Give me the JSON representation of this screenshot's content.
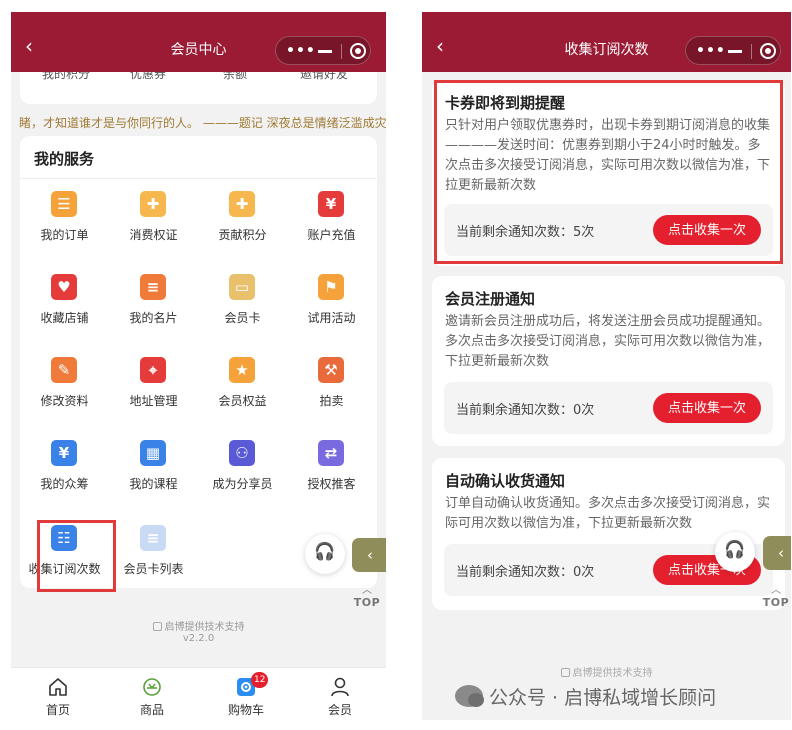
{
  "left": {
    "title": "会员中心",
    "top_card_remnants": [
      "我的积分",
      "优惠券",
      "余额",
      "邀请好友"
    ],
    "marquee": "睹，才知道谁才是与你同行的人。 ———题记 深夜总是情绪泛滥成灾\u0010",
    "service_title": "我的服务",
    "services": [
      {
        "label": "我的订单",
        "icon": "clipboard-icon",
        "color": "#f5a23a",
        "glyph": "☰"
      },
      {
        "label": "消费权证",
        "icon": "gift-icon",
        "color": "#f6b84e",
        "glyph": "✚"
      },
      {
        "label": "贡献积分",
        "icon": "gift-box-icon",
        "color": "#f6b84e",
        "glyph": "✚"
      },
      {
        "label": "账户充值",
        "icon": "recharge-icon",
        "color": "#e53b3b",
        "glyph": "¥"
      },
      {
        "label": "收藏店铺",
        "icon": "favorite-store-icon",
        "color": "#e53b3b",
        "glyph": "♥"
      },
      {
        "label": "我的名片",
        "icon": "business-card-icon",
        "color": "#f07a3a",
        "glyph": "≡"
      },
      {
        "label": "会员卡",
        "icon": "vip-card-icon",
        "color": "#e9c06b",
        "glyph": "▭"
      },
      {
        "label": "试用活动",
        "icon": "trial-flag-icon",
        "color": "#f5a23a",
        "glyph": "⚑"
      },
      {
        "label": "修改资料",
        "icon": "edit-profile-icon",
        "color": "#f07a3a",
        "glyph": "✎"
      },
      {
        "label": "地址管理",
        "icon": "location-icon",
        "color": "#e53b3b",
        "glyph": "⌖"
      },
      {
        "label": "会员权益",
        "icon": "member-badge-icon",
        "color": "#f5a23a",
        "glyph": "★"
      },
      {
        "label": "拍卖",
        "icon": "auction-hammer-icon",
        "color": "#e96a3a",
        "glyph": "⚒"
      },
      {
        "label": "我的众筹",
        "icon": "crowdfunding-icon",
        "color": "#3a82e8",
        "glyph": "¥"
      },
      {
        "label": "我的课程",
        "icon": "course-book-icon",
        "color": "#3a82e8",
        "glyph": "▦"
      },
      {
        "label": "成为分享员",
        "icon": "sharer-icon",
        "color": "#5a5ad6",
        "glyph": "⚇"
      },
      {
        "label": "授权推客",
        "icon": "authorize-icon",
        "color": "#7a6ae0",
        "glyph": "⇄"
      },
      {
        "label": "收集订阅次数",
        "icon": "subscribe-tray-icon",
        "color": "#3a82e8",
        "glyph": "☷"
      },
      {
        "label": "会员卡列表",
        "icon": "card-list-icon",
        "color": "#c9daf5",
        "glyph": "≡"
      }
    ],
    "support_text": "启博提供技术支持",
    "version": "v2.2.0",
    "tabs": [
      {
        "label": "首页",
        "icon": "home-icon"
      },
      {
        "label": "商品",
        "icon": "goods-icon"
      },
      {
        "label": "购物车",
        "icon": "cart-icon",
        "badge": "12"
      },
      {
        "label": "会员",
        "icon": "member-icon"
      }
    ],
    "top_button": "TOP"
  },
  "right": {
    "title": "收集订阅次数",
    "cards": [
      {
        "title": "卡券即将到期提醒",
        "description": "只针对用户领取优惠券时，出现卡券到期订阅消息的收集————发送时间：优惠券到期小于24小时时触发。多次点击多次接受订阅消息，实际可用次数以微信为准，下拉更新最新次数",
        "count_text": "当前剩余通知次数：5次",
        "button": "点击收集一次"
      },
      {
        "title": "会员注册通知",
        "description": "邀请新会员注册成功后，将发送注册会员成功提醒通知。多次点击多次接受订阅消息，实际可用次数以微信为准，下拉更新最新次数",
        "count_text": "当前剩余通知次数：0次",
        "button": "点击收集一次"
      },
      {
        "title": "自动确认收货通知",
        "description": "订单自动确认收货通知。多次点击多次接受订阅消息，实际可用次数以微信为准，下拉更新最新次数",
        "count_text": "当前剩余通知次数：0次",
        "button": "点击收集一次"
      }
    ],
    "support_text": "启博提供技术支持",
    "top_button": "TOP"
  },
  "watermark": "公众号 · 启博私域增长顾问",
  "colors": {
    "nav": "#9b1b34",
    "accent": "#e5202e",
    "highlight": "#e03a3a",
    "side_tab": "#8f8e5a"
  }
}
